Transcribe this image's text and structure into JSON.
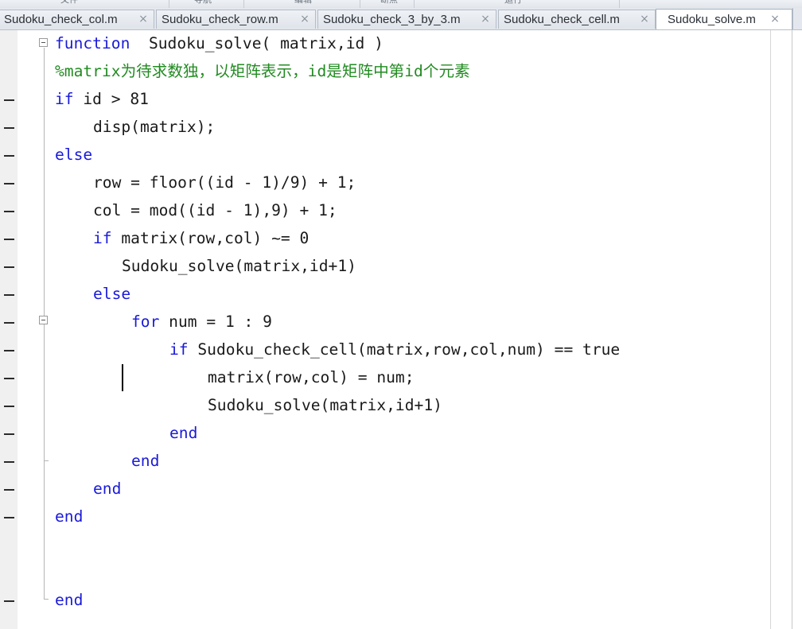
{
  "toolstrip": {
    "sections": [
      "文件",
      "导航",
      "编辑",
      "断点",
      "运行"
    ]
  },
  "tabs": [
    {
      "label": "Sudoku_check_col.m",
      "active": false
    },
    {
      "label": "Sudoku_check_row.m",
      "active": false
    },
    {
      "label": "Sudoku_check_3_by_3.m",
      "active": false
    },
    {
      "label": "Sudoku_check_cell.m",
      "active": false
    },
    {
      "label": "Sudoku_solve.m",
      "active": true
    }
  ],
  "tab_close_glyph": "×",
  "colors": {
    "keyword": "#1a1ad8",
    "comment": "#228b22",
    "text": "#1a1a1a"
  },
  "code": {
    "l1_kw": "function",
    "l1_rest": "  Sudoku_solve( matrix,id )",
    "l2_comment": "%matrix为待求数独，以矩阵表示，id是矩阵中第id个元素",
    "l3_kw": "if",
    "l3_rest": " id > 81",
    "l4": "disp(matrix);",
    "l5_kw": "else",
    "l6": "row = floor((id - 1)/9) + 1;",
    "l7": "col = mod((id - 1),9) + 1;",
    "l8_kw": "if",
    "l8_rest": " matrix(row,col) ~= 0",
    "l9": "Sudoku_solve(matrix,id+1)",
    "l10_kw": "else",
    "l11_kw": "for",
    "l11_rest": " num = 1 : 9",
    "l12_kw": "if",
    "l12_rest": " Sudoku_check_cell(matrix,row,col,num) == true",
    "l13": "matrix(row,col) = num;",
    "l14": "Sudoku_solve(matrix,id+1)",
    "l15_kw": "end",
    "l16_kw": "end",
    "l17_kw": "end",
    "l18_kw": "end",
    "l21_kw": "end"
  }
}
